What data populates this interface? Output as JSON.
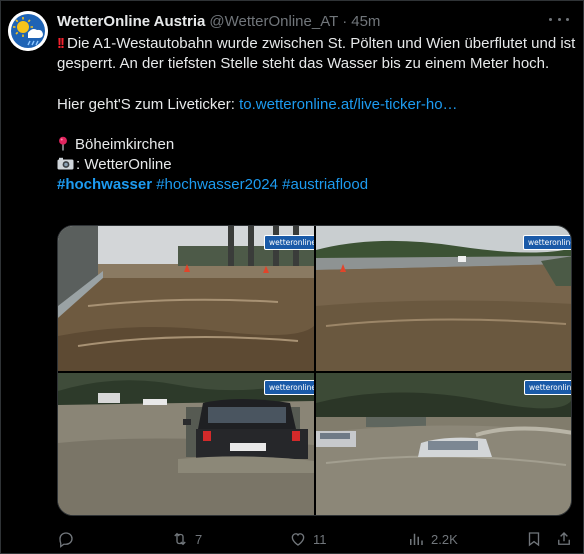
{
  "author": {
    "name": "WetterOnline Austria",
    "handle": "@WetterOnline_AT",
    "time": "45m"
  },
  "text": {
    "line1": "Die A1-Westautobahn wurde zwischen St. Pölten und Wien überflutet und ist gesperrt. An der tiefsten Stelle steht das Wasser bis zu einem Meter hoch.",
    "line2_prefix": "Hier geht'S zum Liveticker: ",
    "line2_link": "to.wetteronline.at/live-ticker-ho…",
    "location": "Böheimkirchen",
    "credit": ": WetterOnline",
    "hashtags": [
      "#hochwasser",
      "#hochwasser2024",
      "#austriaflood"
    ]
  },
  "media": {
    "watermark": "wetteronline"
  },
  "actions": {
    "replies": "",
    "reposts": "7",
    "likes": "11",
    "views": "2.2K"
  },
  "colors": {
    "accent": "#1d9bf0",
    "muted": "#71767b",
    "text": "#e7e9ea",
    "background": "#000000"
  },
  "icons": [
    "avatar-logo",
    "exclamation-icon",
    "pin-icon",
    "camera-icon",
    "reply-icon",
    "repost-icon",
    "like-icon",
    "views-icon",
    "bookmark-icon",
    "share-icon",
    "more-icon"
  ]
}
